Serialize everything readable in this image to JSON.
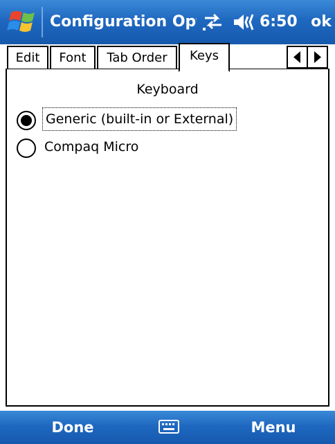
{
  "titlebar": {
    "title": "Configuration Optior",
    "time": "6:50",
    "ok_label": "ok",
    "start_icon": "windows-flag-icon",
    "connectivity_icon": "connectivity-arrows-icon",
    "volume_icon": "speaker-volume-icon"
  },
  "tabs": [
    {
      "label": "Edit",
      "active": false
    },
    {
      "label": "Font",
      "active": false
    },
    {
      "label": "Tab Order",
      "active": false
    },
    {
      "label": "Keys",
      "active": true
    }
  ],
  "tab_scroll": {
    "left_icon": "triangle-left-icon",
    "right_icon": "triangle-right-icon"
  },
  "keys_page": {
    "group_label": "Keyboard",
    "options": [
      {
        "label": "Generic (built-in or External)",
        "selected": true
      },
      {
        "label": "Compaq Micro",
        "selected": false
      }
    ]
  },
  "softkeys": {
    "left": "Done",
    "center_icon": "keyboard-icon",
    "right": "Menu"
  },
  "colors": {
    "bar_blue": "#1f68c0",
    "bar_text": "#ffffff",
    "content_bg": "#ffffff"
  }
}
